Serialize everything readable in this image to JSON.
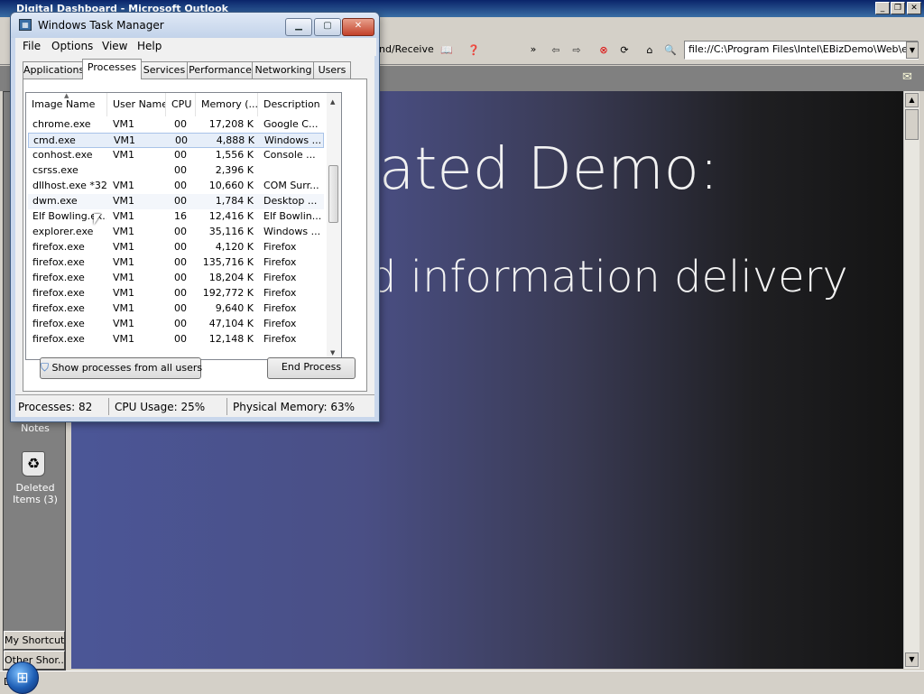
{
  "outlook": {
    "title": "Digital Dashboard - Microsoft Outlook",
    "toolbar": {
      "send_receive": "nd/Receive"
    },
    "address": "file://C:\\Program Files\\Intel\\EBizDemo\\Web\\eBiz",
    "bar_items": {
      "notes": "Notes",
      "deleted": "Deleted\nItems (3)"
    },
    "shortcuts": {
      "my": "My Shortcuts",
      "other": "Other Shor..."
    },
    "status_left": "D"
  },
  "slide": {
    "line1": "ated Demo:",
    "line2": "d information delivery"
  },
  "taskmgr": {
    "title": "Windows Task Manager",
    "menu": [
      "File",
      "Options",
      "View",
      "Help"
    ],
    "tabs": [
      "Applications",
      "Processes",
      "Services",
      "Performance",
      "Networking",
      "Users"
    ],
    "columns": [
      "Image Name",
      "User Name",
      "CPU",
      "Memory (...",
      "Description"
    ],
    "rows": [
      [
        "chrome.exe",
        "VM1",
        "00",
        "17,208 K",
        "Google C..."
      ],
      [
        "cmd.exe",
        "VM1",
        "00",
        "4,888 K",
        "Windows ..."
      ],
      [
        "conhost.exe",
        "VM1",
        "00",
        "1,556 K",
        "Console ..."
      ],
      [
        "csrss.exe",
        "",
        "00",
        "2,396 K",
        ""
      ],
      [
        "dllhost.exe *32",
        "VM1",
        "00",
        "10,660 K",
        "COM Surr..."
      ],
      [
        "dwm.exe",
        "VM1",
        "00",
        "1,784 K",
        "Desktop ..."
      ],
      [
        "Elf Bowling.ex...",
        "VM1",
        "16",
        "12,416 K",
        "Elf Bowlin..."
      ],
      [
        "explorer.exe",
        "VM1",
        "00",
        "35,116 K",
        "Windows ..."
      ],
      [
        "firefox.exe",
        "VM1",
        "00",
        "4,120 K",
        "Firefox"
      ],
      [
        "firefox.exe",
        "VM1",
        "00",
        "135,716 K",
        "Firefox"
      ],
      [
        "firefox.exe",
        "VM1",
        "00",
        "18,204 K",
        "Firefox"
      ],
      [
        "firefox.exe",
        "VM1",
        "00",
        "192,772 K",
        "Firefox"
      ],
      [
        "firefox.exe",
        "VM1",
        "00",
        "9,640 K",
        "Firefox"
      ],
      [
        "firefox.exe",
        "VM1",
        "00",
        "47,104 K",
        "Firefox"
      ],
      [
        "firefox.exe",
        "VM1",
        "00",
        "12,148 K",
        "Firefox"
      ]
    ],
    "show_all_label": "Show processes from all users",
    "end_process_label": "End Process",
    "status": {
      "processes": "Processes: 82",
      "cpu": "CPU Usage: 25%",
      "memory": "Physical Memory: 63%"
    }
  }
}
